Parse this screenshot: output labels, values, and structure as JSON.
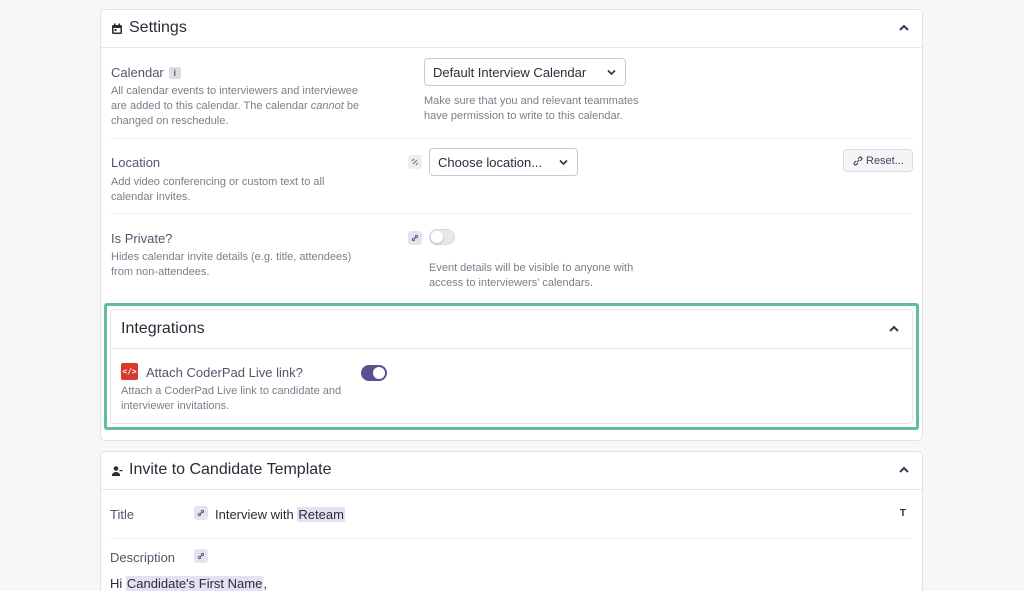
{
  "settings": {
    "title": "Settings",
    "calendar": {
      "label": "Calendar",
      "info": "i",
      "hint_part1": "All calendar events to interviewers and interviewee are added to this calendar. The calendar ",
      "hint_em": "cannot",
      "hint_part2": " be changed on reschedule.",
      "select_value": "Default Interview Calendar",
      "note": "Make sure that you and relevant teammates have permission to write to this calendar."
    },
    "location": {
      "label": "Location",
      "hint": "Add video conferencing or custom text to all calendar invites.",
      "placeholder": "Choose location...",
      "reset_label": "Reset..."
    },
    "private": {
      "label": "Is Private?",
      "hint": "Hides calendar invite details (e.g. title, attendees) from non-attendees.",
      "toggle_value": false,
      "note": "Event details will be visible to anyone with access to interviewers' calendars."
    }
  },
  "integrations": {
    "title": "Integrations",
    "coderpad": {
      "logo_text": "</>",
      "label": "Attach CoderPad Live link?",
      "hint": "Attach a CoderPad Live link to candidate and interviewer invitations.",
      "toggle_value": true
    }
  },
  "invite": {
    "title": "Invite to Candidate Template",
    "title_field": {
      "label": "Title",
      "value_prefix": "Interview with ",
      "value_token": "Reteam",
      "t_icon": "T"
    },
    "description": {
      "label": "Description",
      "greeting_prefix": "Hi ",
      "greeting_token": "Candidate's First Name",
      "greeting_suffix": ","
    }
  },
  "colors": {
    "accent": "#5b5090",
    "highlight_outline": "#5fbf97",
    "token_bg": "#e3e1f3",
    "coderpad_red": "#d9382c"
  },
  "icons": [
    "calendar-icon",
    "chevron-up-icon",
    "info-icon",
    "chevron-down-icon",
    "unlink-icon",
    "link-icon",
    "coderpad-logo",
    "person-icon",
    "text-format-icon"
  ]
}
